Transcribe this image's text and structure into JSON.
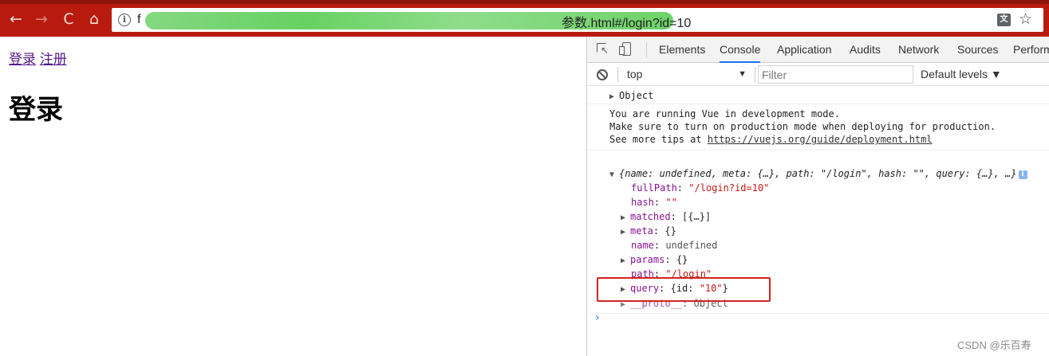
{
  "browser": {
    "nav": {
      "back": "←",
      "forward": "→",
      "reload": "C",
      "home": "⌂"
    },
    "url_prefix": "f",
    "url_visible": "参数.html#/login?id=10",
    "translate_icon": "translate-icon",
    "star_icon": "star-icon"
  },
  "page": {
    "links": [
      "登录",
      "注册"
    ],
    "heading": "登录"
  },
  "devtools": {
    "tabs": [
      "Elements",
      "Console",
      "Application",
      "Audits",
      "Network",
      "Sources",
      "Perform"
    ],
    "active_tab": "Console",
    "context": "top",
    "filter_placeholder": "Filter",
    "levels": "Default levels ▼",
    "caret": "▼",
    "console": {
      "object_line": "Object",
      "vue_msg": [
        "You are running Vue in development mode.",
        "Make sure to turn on production mode when deploying for production.",
        "See more tips at "
      ],
      "vue_link": "https://vuejs.org/guide/deployment.html",
      "route_summary": "{name: undefined, meta: {…}, path: \"/login\", hash: \"\", query: {…}, …}",
      "props": {
        "fullPath_key": "fullPath",
        "fullPath_val": "\"/login?id=10\"",
        "hash_key": "hash",
        "hash_val": "\"\"",
        "matched_key": "matched",
        "matched_val": "[{…}]",
        "meta_key": "meta",
        "meta_val": "{}",
        "name_key": "name",
        "name_val": "undefined",
        "params_key": "params",
        "params_val": "{}",
        "path_key": "path",
        "path_val": "\"/login\"",
        "query_key": "query",
        "query_pre": "{id: ",
        "query_val": "\"10\"",
        "query_post": "}",
        "proto_key": "__proto__",
        "proto_val": "Object"
      },
      "prompt": "›"
    }
  },
  "watermark": "CSDN @乐百寿",
  "colors": {
    "toolbar": "#b81b0e",
    "highlight": "#d32323",
    "active_tab_underline": "#1a73e8"
  }
}
